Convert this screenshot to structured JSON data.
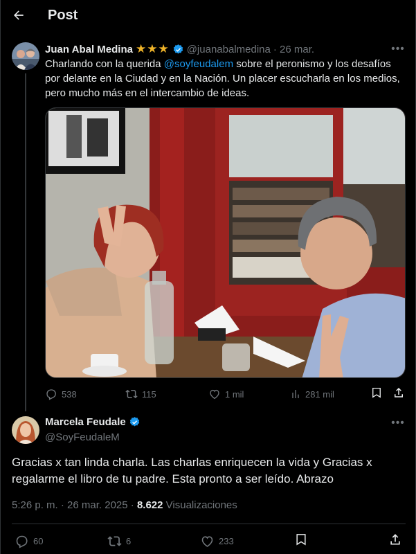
{
  "header": {
    "title": "Post"
  },
  "tweet1": {
    "author_name": "Juan Abal Medina",
    "badge_stars": "★★★",
    "handle": "@juanabalmedina",
    "time": "· 26 mar.",
    "text_before": "Charlando con la querida ",
    "mention": "@soyfeudalem",
    "text_after": " sobre el peronismo y los desafíos por delante en la Ciudad y en la Nación. Un placer escucharla en los medios, pero mucho más en el intercambio de ideas.",
    "replies": "538",
    "reposts": "115",
    "likes": "1 mil",
    "views": "281 mil"
  },
  "tweet2": {
    "author_name": "Marcela Feudale",
    "handle": "@SoyFeudaleM",
    "text": "Gracias x tan linda charla. Las charlas enriquecen la vida y Gracias x regalarme el libro de tu padre. Esta pronto a ser leído. Abrazo",
    "time_date": "5:26 p. m. · 26 mar. 2025 ·",
    "views_count": "8.622",
    "views_label": "Visualizaciones",
    "replies": "60",
    "reposts": "6",
    "likes": "233"
  },
  "colors": {
    "accent": "#1d9bf0",
    "muted": "#71767b",
    "text": "#e7e9ea",
    "background": "#000000",
    "star": "#f0b429"
  }
}
